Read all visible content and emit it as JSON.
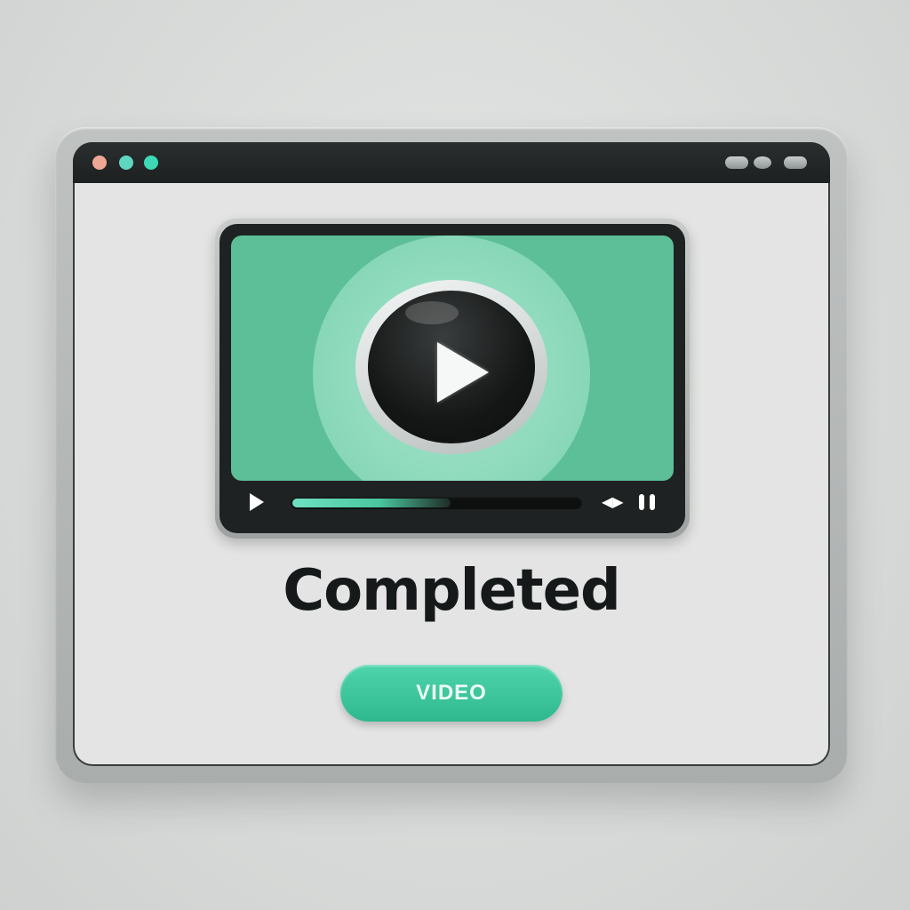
{
  "window": {
    "title_dots": [
      "red-dot",
      "teal-dot",
      "green-dot"
    ],
    "window_controls": [
      "minimize-pill",
      "circle",
      "maximize-pill"
    ]
  },
  "video_player": {
    "play_icon": "play-icon",
    "control_play_icon": "play-icon",
    "volume_icon": "volume-icon",
    "pause_icon": "pause-icon",
    "progress": 0.55,
    "volume_glyph": "◀▶"
  },
  "status": {
    "title": "Completed"
  },
  "action_button": {
    "label": "VIDEO"
  },
  "colors": {
    "accent": "#3ec79c",
    "screen": "#5cbf98",
    "titlebar": "#1d2020",
    "text": "#16191a"
  }
}
